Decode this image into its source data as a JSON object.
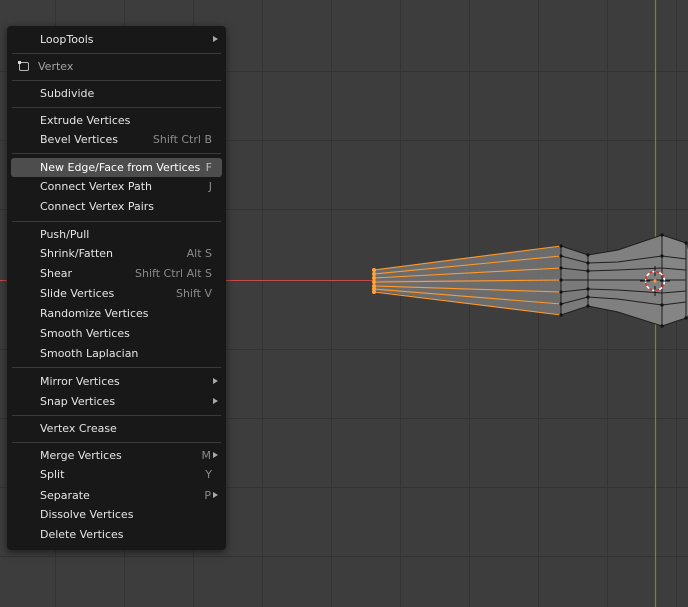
{
  "colors": {
    "viewport_bg": "#3d3d3d",
    "grid_line": "#333333",
    "x_axis": "#c24b4b",
    "y_axis": "#6b8f1f",
    "selected_edge": "#ff9a2e",
    "menu_bg": "#181818",
    "menu_highlight": "#4d4d4d"
  },
  "menu": {
    "loop_tools": "LoopTools",
    "header": "Vertex",
    "subdivide": "Subdivide",
    "extrude_vertices": "Extrude Vertices",
    "bevel_vertices": "Bevel Vertices",
    "bevel_vertices_shortcut": "Shift Ctrl B",
    "new_edge_face": "New Edge/Face from Vertices",
    "new_edge_face_shortcut": "F",
    "connect_vertex_path": "Connect Vertex Path",
    "connect_vertex_path_shortcut": "J",
    "connect_vertex_pairs": "Connect Vertex Pairs",
    "push_pull": "Push/Pull",
    "shrink_fatten": "Shrink/Fatten",
    "shrink_fatten_shortcut": "Alt S",
    "shear": "Shear",
    "shear_shortcut": "Shift Ctrl Alt S",
    "slide_vertices": "Slide Vertices",
    "slide_vertices_shortcut": "Shift V",
    "randomize_vertices": "Randomize Vertices",
    "smooth_vertices": "Smooth Vertices",
    "smooth_laplacian": "Smooth Laplacian",
    "mirror_vertices": "Mirror Vertices",
    "snap_vertices": "Snap Vertices",
    "vertex_crease": "Vertex Crease",
    "merge_vertices": "Merge Vertices",
    "merge_vertices_shortcut": "M",
    "split": "Split",
    "split_shortcut": "Y",
    "separate": "Separate",
    "separate_shortcut": "P",
    "dissolve_vertices": "Dissolve Vertices",
    "delete_vertices": "Delete Vertices"
  }
}
